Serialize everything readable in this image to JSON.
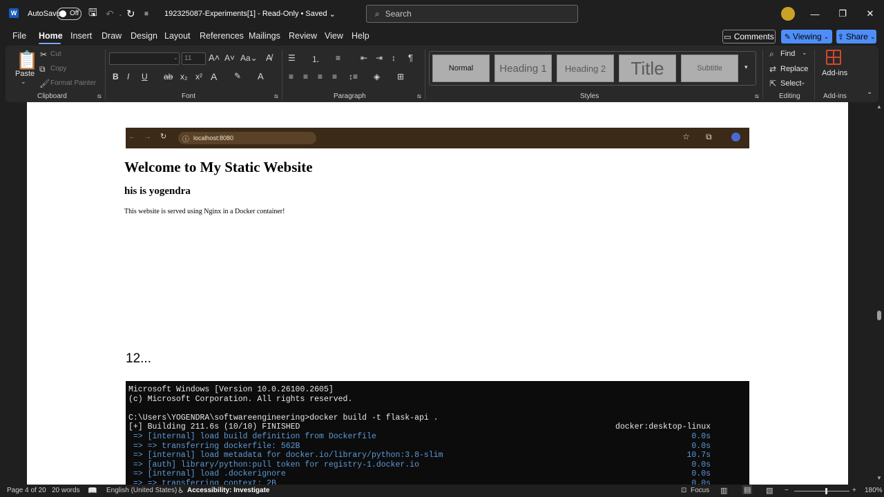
{
  "titlebar": {
    "app_icon_letter": "W",
    "autosave_label": "AutoSave",
    "autosave_state": "Off",
    "document_title": "192325087-Experiments[1]  -  Read-Only • Saved",
    "search_placeholder": "Search"
  },
  "menu": {
    "tabs": [
      "File",
      "Home",
      "Insert",
      "Draw",
      "Design",
      "Layout",
      "References",
      "Mailings",
      "Review",
      "View",
      "Help"
    ],
    "active_tab": "Home",
    "comments_label": "Comments",
    "viewing_label": "Viewing",
    "share_label": "Share"
  },
  "ribbon": {
    "clipboard": {
      "paste": "Paste",
      "cut": "Cut",
      "copy": "Copy",
      "format_painter": "Format Painter",
      "group_label": "Clipboard"
    },
    "font": {
      "size": "11",
      "group_label": "Font"
    },
    "paragraph": {
      "group_label": "Paragraph"
    },
    "styles": {
      "items": [
        "Normal",
        "Heading 1",
        "Heading 2",
        "Title",
        "Subtitle"
      ],
      "group_label": "Styles"
    },
    "editing": {
      "find": "Find",
      "replace": "Replace",
      "select": "Select",
      "group_label": "Editing"
    },
    "addins": {
      "button": "Add-ins",
      "group_label": "Add-ins"
    }
  },
  "document": {
    "browser": {
      "url": "localhost:8080"
    },
    "site_heading": "Welcome to My Static Website",
    "site_subheading": "his is yogendra",
    "site_paragraph": "This website is served using Nginx in a Docker container!",
    "section_marker": "12...",
    "terminal": {
      "lines": [
        {
          "text": "Microsoft Windows [Version 10.0.26100.2605]",
          "right": "",
          "color": "white"
        },
        {
          "text": "(c) Microsoft Corporation. All rights reserved.",
          "right": "",
          "color": "white"
        },
        {
          "text": "",
          "right": "",
          "color": "white"
        },
        {
          "text": "C:\\Users\\YOGENDRA\\softwareengineering>docker build -t flask-api .",
          "right": "",
          "color": "white"
        },
        {
          "text": "[+] Building 211.6s (10/10) FINISHED",
          "right": "docker:desktop-linux",
          "color": "white"
        },
        {
          "text": " => [internal] load build definition from Dockerfile",
          "right": "0.0s",
          "color": "blue"
        },
        {
          "text": " => => transferring dockerfile: 562B",
          "right": "0.0s",
          "color": "blue"
        },
        {
          "text": " => [internal] load metadata for docker.io/library/python:3.8-slim",
          "right": "10.7s",
          "color": "blue"
        },
        {
          "text": " => [auth] library/python:pull token for registry-1.docker.io",
          "right": "0.0s",
          "color": "blue"
        },
        {
          "text": " => [internal] load .dockerignore",
          "right": "0.0s",
          "color": "blue"
        },
        {
          "text": " => => transferring context: 2B",
          "right": "0.0s",
          "color": "blue"
        }
      ]
    }
  },
  "statusbar": {
    "page": "Page 4 of 20",
    "words": "20 words",
    "language": "English (United States)",
    "accessibility": "Accessibility: Investigate",
    "focus": "Focus",
    "zoom": "180%"
  },
  "colors": {
    "accent": "#4f8ef7",
    "brand": "#185abd",
    "terminal_blue": "#5d9ad8"
  }
}
